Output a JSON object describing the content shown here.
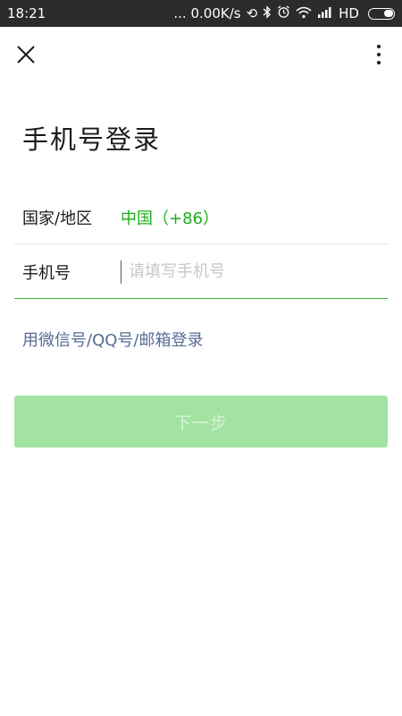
{
  "status_bar": {
    "time": "18:21",
    "network_speed": "... 0.00K/s",
    "hd_label": "HD",
    "icons": [
      "sync-icon",
      "bluetooth-icon",
      "alarm-icon",
      "wifi-icon",
      "signal-icon",
      "battery-icon"
    ]
  },
  "top_bar": {
    "close_icon": "close-icon",
    "more_icon": "more-vertical-icon"
  },
  "page": {
    "title": "手机号登录"
  },
  "form": {
    "region_label": "国家/地区",
    "region_value": "中国（+86）",
    "phone_label": "手机号",
    "phone_placeholder": "请填写手机号",
    "phone_value": ""
  },
  "alt_login_link": "用微信号/QQ号/邮箱登录",
  "next_button": {
    "label": "下一步",
    "enabled": false
  },
  "colors": {
    "accent_green": "#1aad19",
    "link_blue": "#576b95",
    "disabled_button": "#a2e3a2"
  }
}
